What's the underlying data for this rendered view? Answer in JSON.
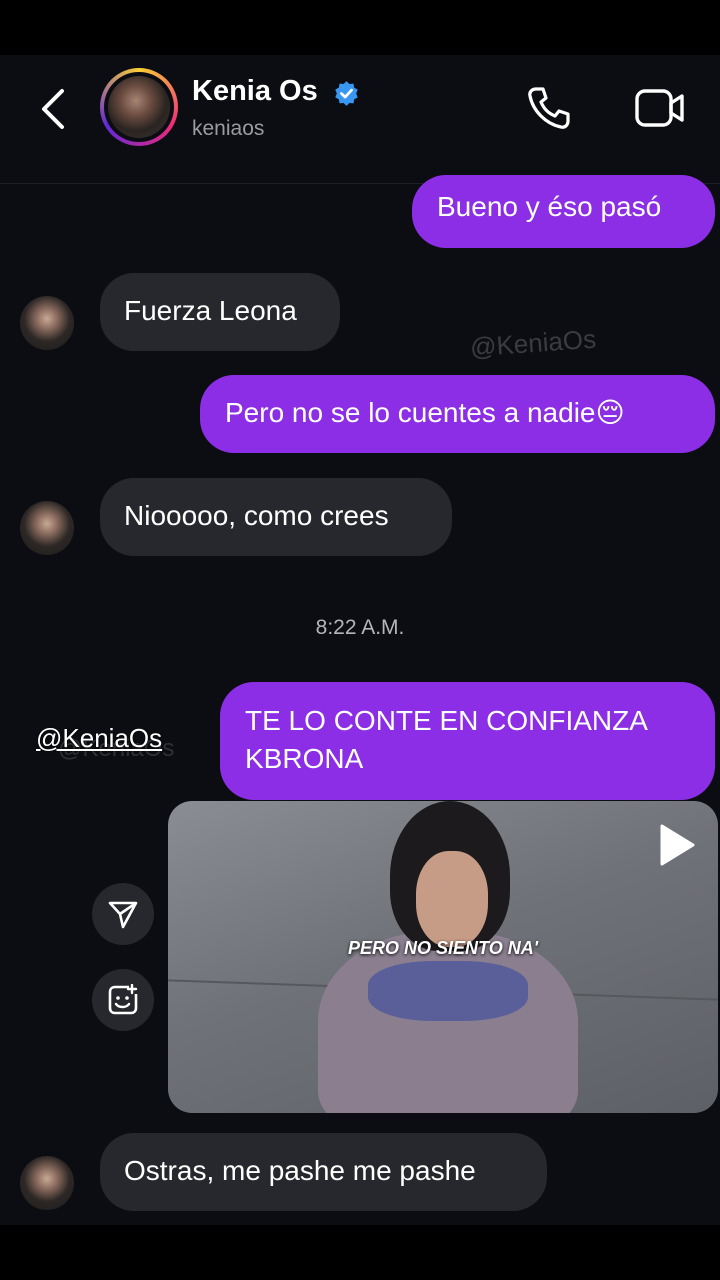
{
  "header": {
    "name": "Kenia Os",
    "username": "keniaos"
  },
  "messages": [
    {
      "dir": "out",
      "text": "Bueno y éso pasó"
    },
    {
      "dir": "in",
      "text": "Fuerza Leona"
    },
    {
      "dir": "out",
      "text": "Pero no se lo cuentes a nadie😔"
    },
    {
      "dir": "in",
      "text": "Niooooo, como crees"
    },
    {
      "dir": "out",
      "text": "TE LO CONTE EN CONFIANZA KBRONA"
    },
    {
      "dir": "in",
      "text": "Ostras, me pashe me pashe"
    }
  ],
  "timestamp": "8:22 A.M.",
  "watermark": "@KeniaOs",
  "overlay_handle": "@KeniaOs",
  "reel": {
    "caption": "PERO NO SIENTO NA'"
  },
  "colors": {
    "outgoing_bubble": "#8c2ee6",
    "incoming_bubble": "#26282d",
    "verified_badge": "#3897f0",
    "background": "#0b0d12"
  }
}
